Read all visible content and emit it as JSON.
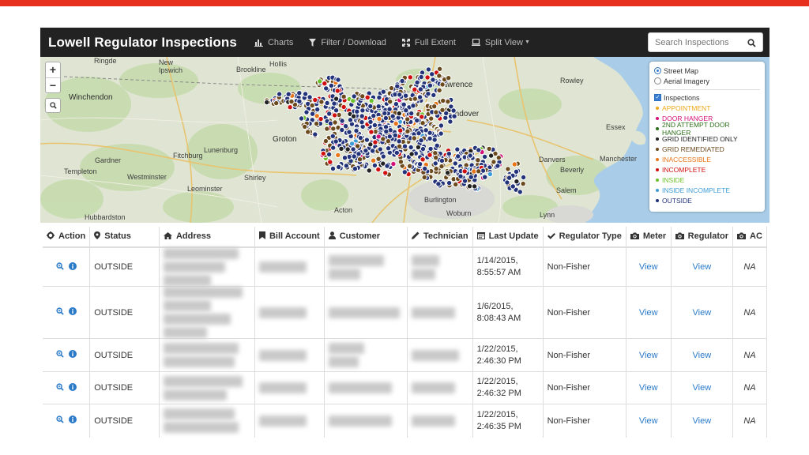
{
  "navbar": {
    "brand": "Lowell Regulator Inspections",
    "items": [
      {
        "label": "Charts",
        "icon": "bar-chart-icon"
      },
      {
        "label": "Filter / Download",
        "icon": "filter-icon"
      },
      {
        "label": "Full Extent",
        "icon": "expand-icon"
      },
      {
        "label": "Split View",
        "icon": "laptop-icon"
      }
    ],
    "search_placeholder": "Search Inspections"
  },
  "map": {
    "cities": [
      "Ringde",
      "New Ipswich",
      "Hollis",
      "Brookline",
      "Lawrence",
      "Rowley",
      "Winchendon",
      "Andover",
      "Groton",
      "Essex",
      "Lunenburg",
      "Fitchburg",
      "Gardner",
      "Templeton",
      "Westminster",
      "Shirley",
      "Danvers",
      "Manchester",
      "Beverly",
      "Leominster",
      "Salem",
      "Acton",
      "Burlington",
      "Hubbardston",
      "Woburn",
      "Lynn"
    ],
    "basemap_options": [
      {
        "label": "Street Map",
        "selected": true
      },
      {
        "label": "Aerial Imagery",
        "selected": false
      }
    ],
    "layer_label": "Inspections",
    "layer_checked": true,
    "categories": [
      {
        "label": "APPOINTMENT",
        "color": "#f0a818"
      },
      {
        "label": "DOOR HANGER",
        "color": "#d4127a"
      },
      {
        "label": "2ND ATTEMPT DOOR HANGER",
        "color": "#2d6e19"
      },
      {
        "label": "GRID IDENTIFIED ONLY",
        "color": "#222222"
      },
      {
        "label": "GRID REMEDIATED",
        "color": "#6b4a1e"
      },
      {
        "label": "INACCESSIBLE",
        "color": "#e8751a"
      },
      {
        "label": "INCOMPLETE",
        "color": "#d01010"
      },
      {
        "label": "INSIDE",
        "color": "#6cc02a"
      },
      {
        "label": "INSIDE INCOMPLETE",
        "color": "#3d9dd6"
      },
      {
        "label": "OUTSIDE",
        "color": "#23337a"
      }
    ]
  },
  "table": {
    "headers": [
      {
        "label": "Action",
        "icon": "gear-icon"
      },
      {
        "label": "Status",
        "icon": "map-marker-icon"
      },
      {
        "label": "Address",
        "icon": "home-icon"
      },
      {
        "label": "Bill Account",
        "icon": "bookmark-icon"
      },
      {
        "label": "Customer",
        "icon": "user-icon"
      },
      {
        "label": "Technician",
        "icon": "pencil-icon"
      },
      {
        "label": "Last Update",
        "icon": "calendar-icon"
      },
      {
        "label": "Regulator Type",
        "icon": "check-icon"
      },
      {
        "label": "Meter",
        "icon": "camera-icon"
      },
      {
        "label": "Regulator",
        "icon": "camera-icon"
      },
      {
        "label": "AC",
        "icon": "camera-icon"
      }
    ],
    "rows": [
      {
        "status": "OUTSIDE",
        "date": "1/14/2015,",
        "time": "8:55:57 AM",
        "type": "Non-Fisher",
        "meter": "View",
        "regulator": "View",
        "ac": "NA"
      },
      {
        "status": "OUTSIDE",
        "date": "1/6/2015,",
        "time": "8:08:43 AM",
        "type": "Non-Fisher",
        "meter": "View",
        "regulator": "View",
        "ac": "NA"
      },
      {
        "status": "OUTSIDE",
        "date": "1/22/2015,",
        "time": "2:46:30 PM",
        "type": "Non-Fisher",
        "meter": "View",
        "regulator": "View",
        "ac": "NA"
      },
      {
        "status": "OUTSIDE",
        "date": "1/22/2015,",
        "time": "2:46:32 PM",
        "type": "Non-Fisher",
        "meter": "View",
        "regulator": "View",
        "ac": "NA"
      },
      {
        "status": "OUTSIDE",
        "date": "1/22/2015,",
        "time": "2:46:35 PM",
        "type": "Non-Fisher",
        "meter": "View",
        "regulator": "View",
        "ac": "NA"
      }
    ]
  }
}
